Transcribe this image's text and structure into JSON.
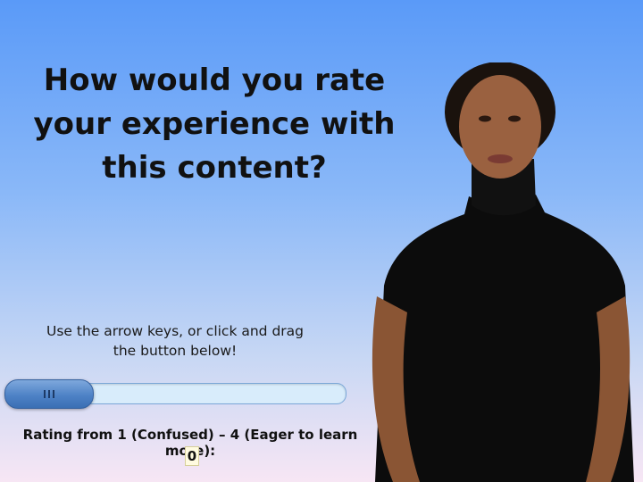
{
  "question": {
    "title": "How would you rate your experience with this content?"
  },
  "instructions": {
    "text": "Use the arrow keys, or click and drag the button below!"
  },
  "slider": {
    "min": 1,
    "max": 4,
    "current": 0,
    "handle_icon": "grip-lines-icon"
  },
  "rating": {
    "label": "Rating from 1 (Confused) – 4 (Eager to learn more):",
    "value": "0"
  },
  "colors": {
    "background_top": "#5a9af8",
    "background_bottom": "#f7e6f4",
    "handle": "#4e82c6",
    "track": "#d8ecfb"
  }
}
